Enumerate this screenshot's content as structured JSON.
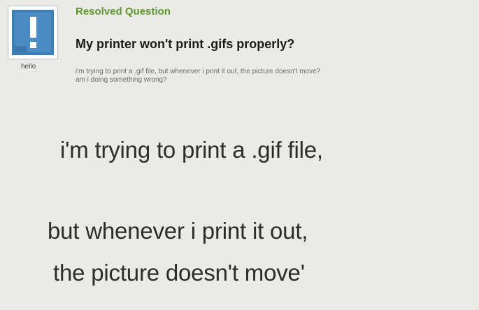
{
  "question": {
    "status": "Resolved Question",
    "title": "My printer won't print .gifs properly?",
    "details_line1": "i'm trying to print a .gif file, but whenever i print it out, the picture doesn't move?",
    "details_line2": "am i doing something wrong?"
  },
  "asker": {
    "name": "hello",
    "avatar_icon": "question-mark-avatar-icon"
  },
  "caption": {
    "line1": "i'm trying to print a .gif file,",
    "line2": "but whenever i print it out,",
    "line3": "the picture doesn't move'"
  },
  "colors": {
    "resolved_green": "#5c9a2e",
    "avatar_blue": "#3e7fb8",
    "avatar_border": "#b9c0c7",
    "background": "#eaebe7"
  }
}
